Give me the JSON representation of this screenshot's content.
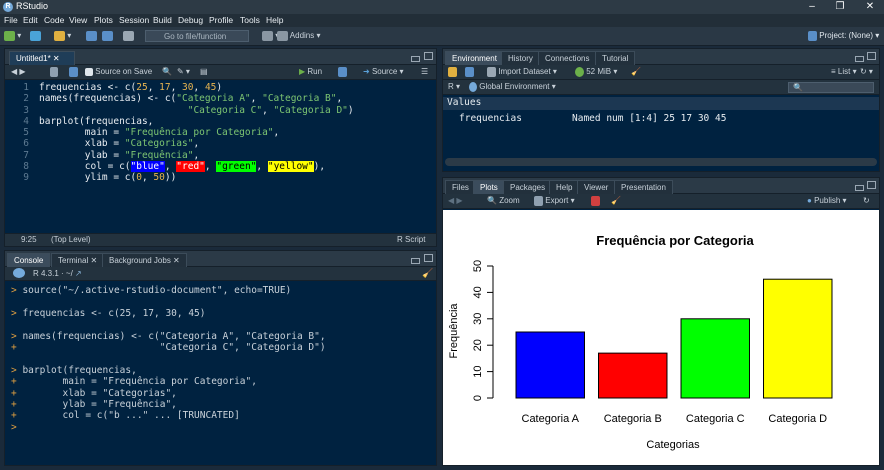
{
  "app": {
    "title": "RStudio",
    "project": "Project: (None)"
  },
  "menu": [
    "File",
    "Edit",
    "Code",
    "View",
    "Plots",
    "Session",
    "Build",
    "Debug",
    "Profile",
    "Tools",
    "Help"
  ],
  "toolbar": {
    "goto": "Go to file/function",
    "addins": "Addins"
  },
  "editor": {
    "tab": "Untitled1*",
    "source_on_save": "Source on Save",
    "run": "Run",
    "source": "Source",
    "lines": [
      [
        {
          "t": "frequencias <- c(",
          "c": ""
        },
        {
          "t": "25",
          "c": "num"
        },
        {
          "t": ", ",
          "c": ""
        },
        {
          "t": "17",
          "c": "num"
        },
        {
          "t": ", ",
          "c": ""
        },
        {
          "t": "30",
          "c": "num"
        },
        {
          "t": ", ",
          "c": ""
        },
        {
          "t": "45",
          "c": "num"
        },
        {
          "t": ")",
          "c": ""
        }
      ],
      [
        {
          "t": "names(frequencias) <- c(",
          "c": ""
        },
        {
          "t": "\"Categoria A\"",
          "c": "str"
        },
        {
          "t": ", ",
          "c": ""
        },
        {
          "t": "\"Categoria B\"",
          "c": "str"
        },
        {
          "t": ",",
          "c": ""
        }
      ],
      [
        {
          "t": "                          ",
          "c": ""
        },
        {
          "t": "\"Categoria C\"",
          "c": "str"
        },
        {
          "t": ", ",
          "c": ""
        },
        {
          "t": "\"Categoria D\"",
          "c": "str"
        },
        {
          "t": ")",
          "c": ""
        }
      ],
      [
        {
          "t": "barplot(frequencias,",
          "c": ""
        }
      ],
      [
        {
          "t": "        main = ",
          "c": ""
        },
        {
          "t": "\"Frequência por Categoria\"",
          "c": "str"
        },
        {
          "t": ",",
          "c": ""
        }
      ],
      [
        {
          "t": "        xlab = ",
          "c": ""
        },
        {
          "t": "\"Categorias\"",
          "c": "str"
        },
        {
          "t": ",",
          "c": ""
        }
      ],
      [
        {
          "t": "        ylab = ",
          "c": ""
        },
        {
          "t": "\"Frequência\"",
          "c": "str"
        },
        {
          "t": ",",
          "c": ""
        }
      ],
      [
        {
          "t": "        col = c(",
          "c": ""
        },
        {
          "t": "\"blue\"",
          "c": "hl-blue"
        },
        {
          "t": ", ",
          "c": ""
        },
        {
          "t": "\"red\"",
          "c": "hl-red"
        },
        {
          "t": ", ",
          "c": ""
        },
        {
          "t": "\"green\"",
          "c": "hl-green"
        },
        {
          "t": ", ",
          "c": ""
        },
        {
          "t": "\"yellow\"",
          "c": "hl-yellow"
        },
        {
          "t": "),",
          "c": ""
        }
      ],
      [
        {
          "t": "        ylim = c(",
          "c": ""
        },
        {
          "t": "0",
          "c": "num"
        },
        {
          "t": ", ",
          "c": ""
        },
        {
          "t": "50",
          "c": "num"
        },
        {
          "t": "))",
          "c": ""
        }
      ]
    ],
    "status_pos": "9:25",
    "status_scope": "(Top Level)",
    "status_type": "R Script"
  },
  "console": {
    "tabs": [
      "Console",
      "Terminal",
      "Background Jobs"
    ],
    "version": "R 4.3.1 · ~/",
    "lines": [
      {
        "p": ">",
        "t": " source(\"~/.active-rstudio-document\", echo=TRUE)"
      },
      {
        "p": "",
        "t": ""
      },
      {
        "p": ">",
        "t": " frequencias <- c(25, 17, 30, 45)"
      },
      {
        "p": "",
        "t": ""
      },
      {
        "p": ">",
        "t": " names(frequencias) <- c(\"Categoria A\", \"Categoria B\","
      },
      {
        "p": "+",
        "t": "                         \"Categoria C\", \"Categoria D\")"
      },
      {
        "p": "",
        "t": ""
      },
      {
        "p": ">",
        "t": " barplot(frequencias,"
      },
      {
        "p": "+",
        "t": "        main = \"Frequência por Categoria\","
      },
      {
        "p": "+",
        "t": "        xlab = \"Categorias\","
      },
      {
        "p": "+",
        "t": "        ylab = \"Frequência\","
      },
      {
        "p": "+",
        "t": "        col = c(\"b ...\" ... [TRUNCATED]"
      },
      {
        "p": ">",
        "t": ""
      }
    ]
  },
  "env": {
    "tabs": [
      "Environment",
      "History",
      "Connections",
      "Tutorial"
    ],
    "import": "Import Dataset",
    "mem": "52 MiB",
    "list": "List",
    "lang": "R",
    "scope": "Global Environment",
    "section": "Values",
    "var_name": "frequencias",
    "var_value": "Named num [1:4] 25 17 30 45"
  },
  "plots": {
    "tabs": [
      "Files",
      "Plots",
      "Packages",
      "Help",
      "Viewer",
      "Presentation"
    ],
    "zoom": "Zoom",
    "export": "Export",
    "publish": "Publish"
  },
  "chart_data": {
    "type": "bar",
    "title": "Frequência por Categoria",
    "xlabel": "Categorias",
    "ylabel": "Frequência",
    "categories": [
      "Categoria A",
      "Categoria B",
      "Categoria C",
      "Categoria D"
    ],
    "values": [
      25,
      17,
      30,
      45
    ],
    "colors": [
      "#0000ff",
      "#ff0000",
      "#00ff00",
      "#ffff00"
    ],
    "ylim": [
      0,
      50
    ],
    "yticks": [
      "0",
      "10",
      "20",
      "30",
      "40",
      "50"
    ]
  }
}
